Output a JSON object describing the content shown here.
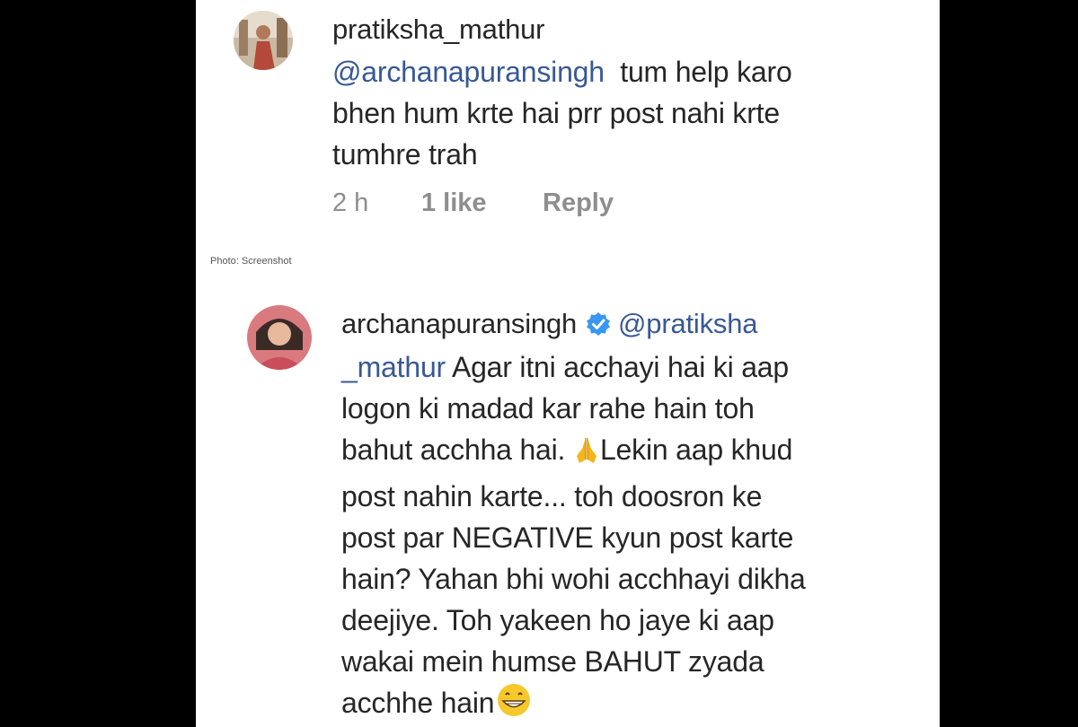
{
  "comment1": {
    "username": "pratiksha_mathur",
    "mention": "@archanapuransingh",
    "line1_rest": "tum help karo",
    "line2": "bhen hum krte hai prr post nahi krte",
    "line3": "tumhre trah",
    "time": "2 h",
    "likes": "1 like",
    "reply": "Reply",
    "avatar_icon": "user-photo-avatar"
  },
  "photo_caption": "Photo: Screenshot",
  "comment2": {
    "username": "archanapuransingh",
    "verified_icon": "verified-badge-icon",
    "mention_part1": "@pratiksha",
    "mention_part2": "_mathur",
    "line2_rest": "Agar itni acchayi hai ki aap",
    "line3": "logon ki madad kar rahe hain toh",
    "line4a": "bahut acchha hai.",
    "line4b": "Lekin aap khud",
    "line5": "post nahin karte... toh doosron ke",
    "line6": "post par NEGATIVE kyun post karte",
    "line7": "hain? Yahan bhi wohi acchhayi dikha",
    "line8": "deejiye. Toh yakeen ho jaye ki aap",
    "line9": "wakai mein humse BAHUT zyada",
    "line10": "acchhe hain",
    "emoji_pray": "folded-hands-emoji",
    "emoji_grin": "grinning-emoji",
    "avatar_icon": "user-photo-avatar"
  },
  "colors": {
    "background": "#000000",
    "panel": "#ffffff",
    "text": "#262626",
    "mention": "#385898",
    "meta": "#8e8e8e",
    "verified": "#3897f0"
  }
}
